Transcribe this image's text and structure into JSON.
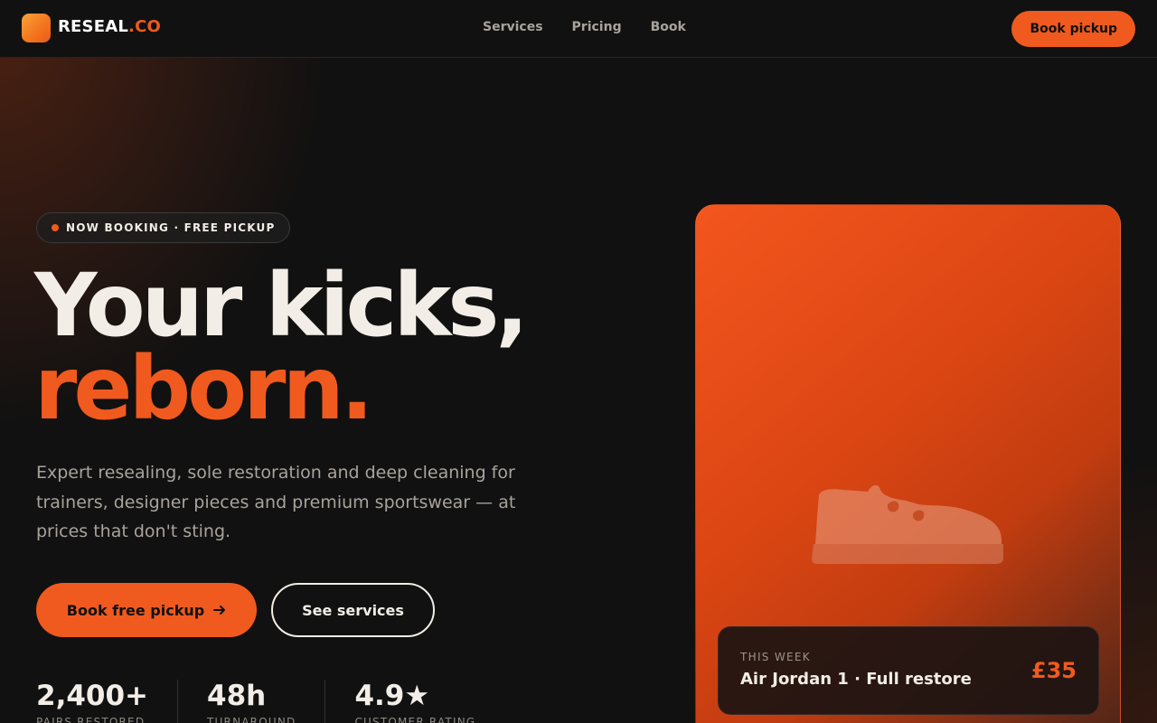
{
  "brand": {
    "name": "RESEAL",
    "suffix": ".CO",
    "accent_color": "#f05a1e"
  },
  "nav": {
    "links": [
      "Services",
      "Pricing",
      "Book"
    ],
    "cta_label": "Book pickup"
  },
  "hero": {
    "badge": "NOW BOOKING · FREE PICKUP",
    "headline_line1": "Your kicks,",
    "headline_line2": "reborn.",
    "subtext": "Expert resealing, sole restoration and deep cleaning for trainers, designer pieces and premium sportswear — at prices that don't sting.",
    "primary_cta": "Book free pickup",
    "primary_cta_icon": "arrow-right-icon",
    "secondary_cta": "See services"
  },
  "stats": [
    {
      "value": "2,400+",
      "label": "PAIRS RESTORED"
    },
    {
      "value": "48h",
      "label": "TURNAROUND"
    },
    {
      "value": "4.9★",
      "label": "CUSTOMER RATING"
    }
  ],
  "feature_card": {
    "image_icon": "sneaker-icon",
    "kicker": "THIS WEEK",
    "title": "Air Jordan 1 · Full restore",
    "price": "£35"
  },
  "colors": {
    "background": "#111111",
    "accent": "#f05a1e",
    "text": "#f2ede6",
    "muted": "#a8a39c"
  }
}
